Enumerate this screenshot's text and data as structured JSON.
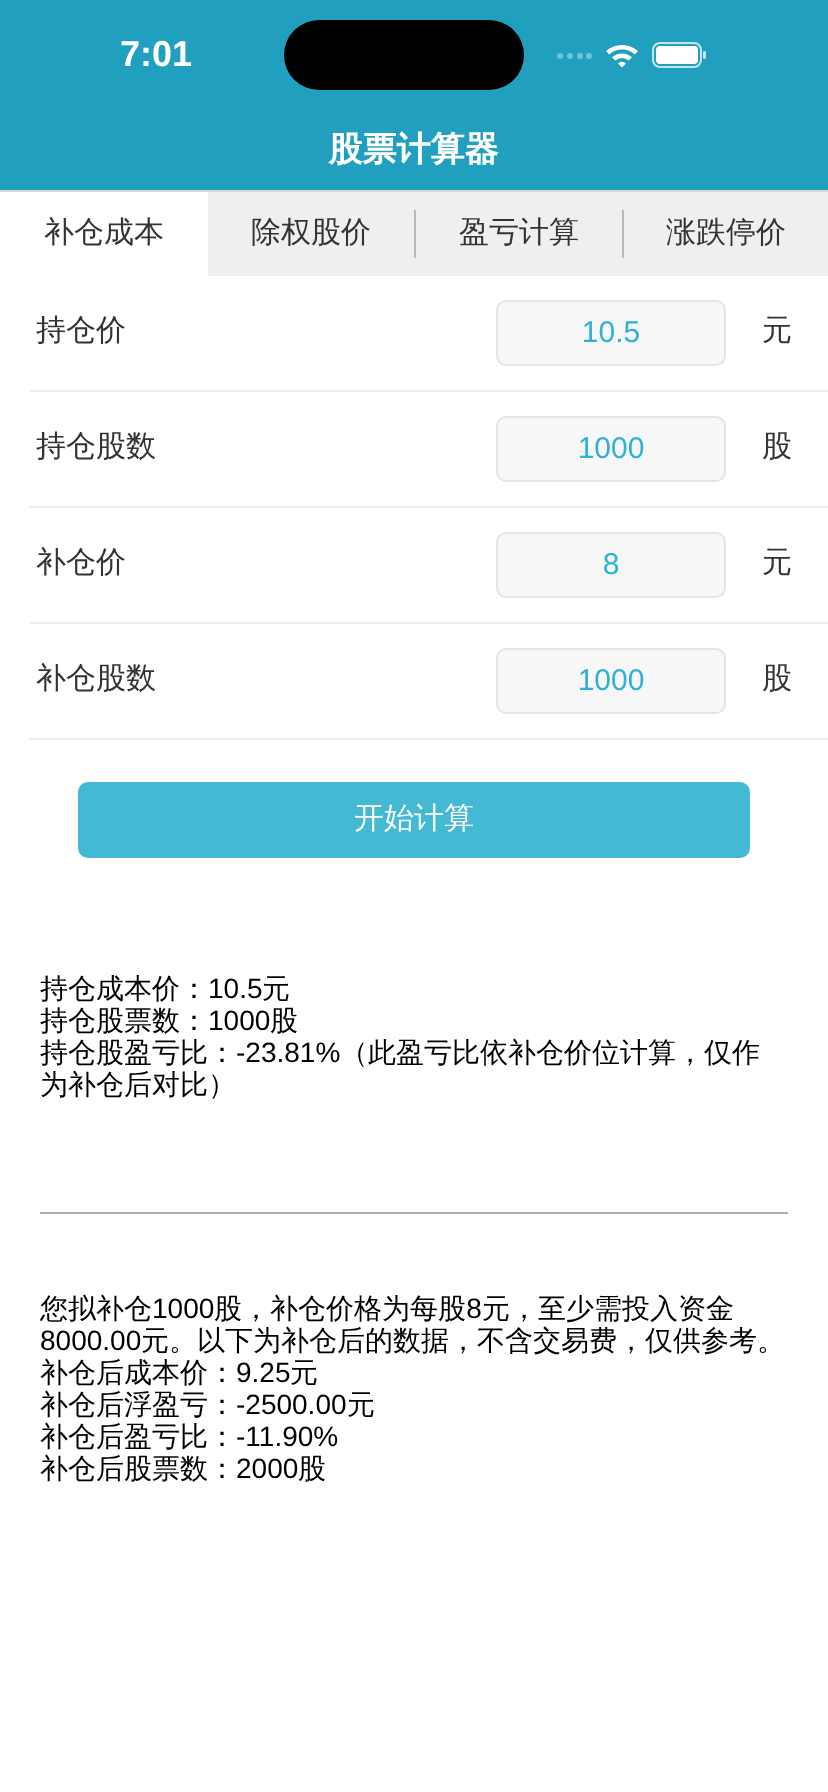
{
  "status_bar": {
    "time": "7:01"
  },
  "title": "股票计算器",
  "tabs": [
    {
      "label": "补仓成本",
      "selected": true
    },
    {
      "label": "除权股价",
      "selected": false
    },
    {
      "label": "盈亏计算",
      "selected": false
    },
    {
      "label": "涨跌停价",
      "selected": false
    }
  ],
  "fields": [
    {
      "label": "持仓价",
      "value": "10.5",
      "unit": "元"
    },
    {
      "label": "持仓股数",
      "value": "1000",
      "unit": "股"
    },
    {
      "label": "补仓价",
      "value": "8",
      "unit": "元"
    },
    {
      "label": "补仓股数",
      "value": "1000",
      "unit": "股"
    }
  ],
  "calculate_button": "开始计算",
  "current_result": [
    "持仓成本价：10.5元",
    "持仓股票数：1000股",
    "持仓股盈亏比：-23.81%（此盈亏比依补仓价位计算，仅作为补仓后对比）"
  ],
  "after_result": [
    "您拟补仓1000股，补仓价格为每股8元，至少需投入资金8000.00元。以下为补仓后的数据，不含交易费，仅供参考。",
    "补仓后成本价：9.25元",
    "补仓后浮盈亏：-2500.00元",
    "补仓后盈亏比：-11.90%",
    "补仓后股票数：2000股"
  ]
}
